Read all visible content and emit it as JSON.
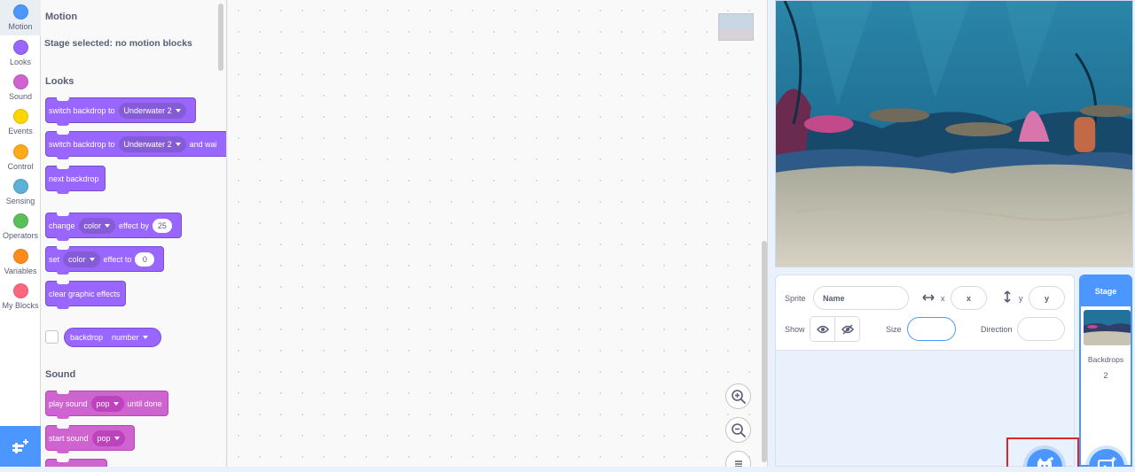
{
  "categories": [
    {
      "label": "Motion",
      "color": "#4c97ff",
      "icon": "motion-dot-icon"
    },
    {
      "label": "Looks",
      "color": "#9966ff",
      "icon": "looks-dot-icon"
    },
    {
      "label": "Sound",
      "color": "#cf63cf",
      "icon": "sound-dot-icon"
    },
    {
      "label": "Events",
      "color": "#ffd500",
      "icon": "events-dot-icon"
    },
    {
      "label": "Control",
      "color": "#ffab19",
      "icon": "control-dot-icon"
    },
    {
      "label": "Sensing",
      "color": "#5cb1d6",
      "icon": "sensing-dot-icon"
    },
    {
      "label": "Operators",
      "color": "#59c059",
      "icon": "operators-dot-icon"
    },
    {
      "label": "Variables",
      "color": "#ff8c1a",
      "icon": "variables-dot-icon"
    },
    {
      "label": "My Blocks",
      "color": "#ff6680",
      "icon": "myblocks-dot-icon"
    }
  ],
  "palette": {
    "motion_title": "Motion",
    "motion_note": "Stage selected: no motion blocks",
    "looks_title": "Looks",
    "sound_title": "Sound",
    "blocks": {
      "switch_backdrop": {
        "text": "switch backdrop to",
        "menu": "Underwater 2"
      },
      "switch_backdrop_wait": {
        "text": "switch backdrop to",
        "menu": "Underwater 2",
        "suffix": "and wai"
      },
      "next_backdrop": {
        "text": "next backdrop"
      },
      "change_effect": {
        "text": "change",
        "menu": "color",
        "mid": "effect by",
        "value": "25"
      },
      "set_effect": {
        "text": "set",
        "menu": "color",
        "mid": "effect to",
        "value": "0"
      },
      "clear_effects": {
        "text": "clear graphic effects"
      },
      "backdrop_reporter": {
        "text": "backdrop",
        "menu": "number"
      },
      "play_sound": {
        "text": "play sound",
        "menu": "pop",
        "suffix": "until done"
      },
      "start_sound": {
        "text": "start sound",
        "menu": "pop"
      }
    }
  },
  "sprite_info": {
    "sprite_label": "Sprite",
    "name_placeholder": "Name",
    "x_label": "x",
    "x_placeholder": "x",
    "y_label": "y",
    "y_placeholder": "y",
    "show_label": "Show",
    "size_label": "Size",
    "direction_label": "Direction"
  },
  "stage_selector": {
    "title": "Stage",
    "backdrops_label": "Backdrops",
    "backdrops_count": "2"
  },
  "colors": {
    "accent": "#4c97ff",
    "looks": "#9966ff",
    "sound": "#cf63cf",
    "highlight": "#e0242b"
  }
}
